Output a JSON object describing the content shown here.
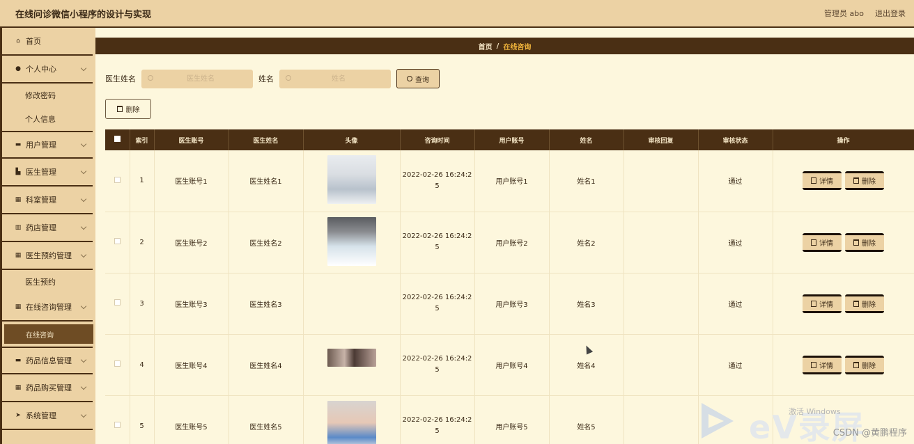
{
  "app": {
    "title": "在线问诊微信小程序的设计与实现",
    "user_label": "管理员 abo",
    "logout_label": "退出登录"
  },
  "sidebar": {
    "items": [
      {
        "label": "首页",
        "icon": "home-icon"
      },
      {
        "label": "个人中心",
        "icon": "user-icon"
      },
      {
        "label": "修改密码",
        "sub": true
      },
      {
        "label": "个人信息",
        "sub": true
      },
      {
        "label": "用户管理",
        "icon": "briefcase-icon"
      },
      {
        "label": "医生管理",
        "icon": "doctor-icon"
      },
      {
        "label": "科室管理",
        "icon": "grid-icon"
      },
      {
        "label": "药店管理",
        "icon": "chart-icon"
      },
      {
        "label": "医生预约管理",
        "icon": "grid-icon"
      },
      {
        "label": "医生预约",
        "sub": true
      },
      {
        "label": "在线咨询管理",
        "icon": "grid-icon"
      },
      {
        "label": "在线咨询",
        "sub": true,
        "active": true
      },
      {
        "label": "药品信息管理",
        "icon": "briefcase-icon"
      },
      {
        "label": "药品购买管理",
        "icon": "grid-icon"
      },
      {
        "label": "系统管理",
        "icon": "send-icon"
      }
    ]
  },
  "breadcrumb": {
    "home": "首页",
    "separator": "/",
    "current": "在线咨询"
  },
  "search": {
    "doctor_name_label": "医生姓名",
    "doctor_name_placeholder": "医生姓名",
    "name_label": "姓名",
    "name_placeholder": "姓名",
    "query_label": "查询"
  },
  "actions": {
    "delete_label": "删除"
  },
  "table": {
    "headers": [
      "",
      "索引",
      "医生账号",
      "医生姓名",
      "头像",
      "咨询时间",
      "用户账号",
      "姓名",
      "审核回复",
      "审核状态",
      "操作"
    ],
    "detail_label": "详情",
    "delete_label": "删除",
    "rows": [
      {
        "index": "1",
        "doctor_account": "医生账号1",
        "doctor_name": "医生姓名1",
        "time_line1": "2022-02-26 16:24:2",
        "time_line2": "5",
        "user_account": "用户账号1",
        "name": "姓名1",
        "reply": "",
        "status": "通过"
      },
      {
        "index": "2",
        "doctor_account": "医生账号2",
        "doctor_name": "医生姓名2",
        "time_line1": "2022-02-26 16:24:2",
        "time_line2": "5",
        "user_account": "用户账号2",
        "name": "姓名2",
        "reply": "",
        "status": "通过"
      },
      {
        "index": "3",
        "doctor_account": "医生账号3",
        "doctor_name": "医生姓名3",
        "time_line1": "2022-02-26 16:24:2",
        "time_line2": "5",
        "user_account": "用户账号3",
        "name": "姓名3",
        "reply": "",
        "status": "通过"
      },
      {
        "index": "4",
        "doctor_account": "医生账号4",
        "doctor_name": "医生姓名4",
        "time_line1": "2022-02-26 16:24:2",
        "time_line2": "5",
        "user_account": "用户账号4",
        "name": "姓名4",
        "reply": "",
        "status": "通过"
      },
      {
        "index": "5",
        "doctor_account": "医生账号5",
        "doctor_name": "医生姓名5",
        "time_line1": "2022-02-26 16:24:2",
        "time_line2": "5",
        "user_account": "用户账号5",
        "name": "姓名5",
        "reply": "",
        "status": ""
      }
    ]
  },
  "overlay": {
    "ev_text": "eV录屏",
    "activate_text": "激活 Windows",
    "csdn_watermark": "CSDN @黄鹏程序"
  },
  "colors": {
    "header_bg": "#ecd2a4",
    "dark_brown": "#4a2f14",
    "page_bg": "#fdf7dd",
    "accent": "#f0b43c"
  }
}
